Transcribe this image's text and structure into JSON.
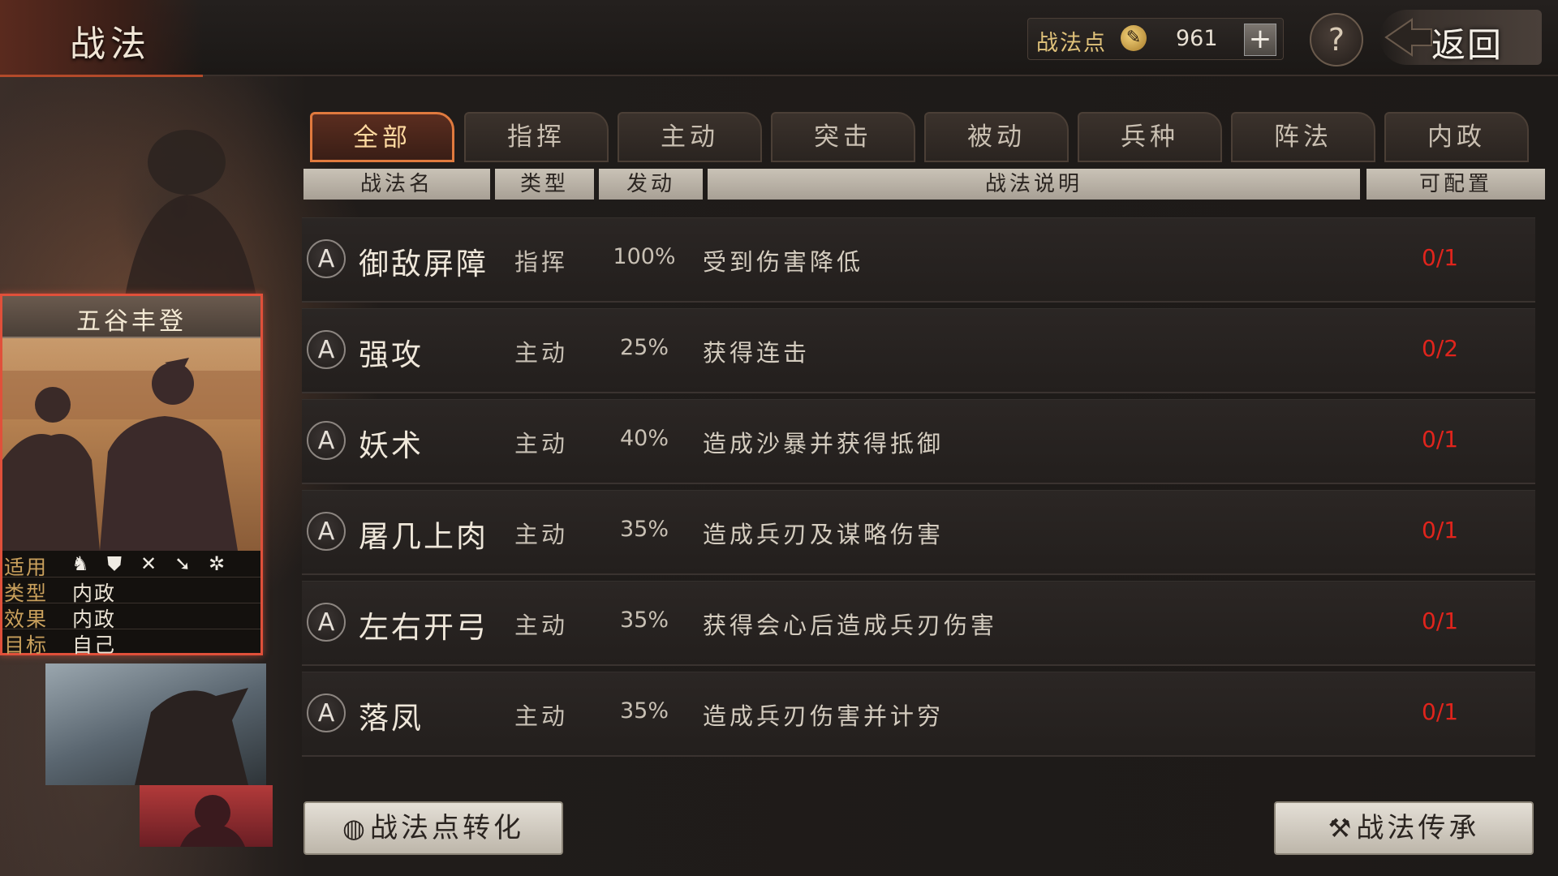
{
  "header": {
    "title": "战法",
    "points_label": "战法点",
    "points_icon": "feather-coin-icon",
    "points_value": "961",
    "plus_label": "+",
    "help_label": "?",
    "back_label": "返回"
  },
  "tabs": [
    {
      "label": "全部",
      "active": true
    },
    {
      "label": "指挥",
      "active": false
    },
    {
      "label": "主动",
      "active": false
    },
    {
      "label": "突击",
      "active": false
    },
    {
      "label": "被动",
      "active": false
    },
    {
      "label": "兵种",
      "active": false
    },
    {
      "label": "阵法",
      "active": false
    },
    {
      "label": "内政",
      "active": false
    }
  ],
  "columns": {
    "name": "战法名",
    "type": "类型",
    "trigger": "发动",
    "description": "战法说明",
    "configurable": "可配置"
  },
  "rows": [
    {
      "grade": "A",
      "name": "御敌屏障",
      "type": "指挥",
      "rate": "100%",
      "description": "受到伤害降低",
      "count": "0/1"
    },
    {
      "grade": "A",
      "name": "强攻",
      "type": "主动",
      "rate": "25%",
      "description": "获得连击",
      "count": "0/2"
    },
    {
      "grade": "A",
      "name": "妖术",
      "type": "主动",
      "rate": "40%",
      "description": "造成沙暴并获得抵御",
      "count": "0/1"
    },
    {
      "grade": "A",
      "name": "屠几上肉",
      "type": "主动",
      "rate": "35%",
      "description": "造成兵刃及谋略伤害",
      "count": "0/1"
    },
    {
      "grade": "A",
      "name": "左右开弓",
      "type": "主动",
      "rate": "35%",
      "description": "获得会心后造成兵刃伤害",
      "count": "0/1"
    },
    {
      "grade": "A",
      "name": "落凤",
      "type": "主动",
      "rate": "35%",
      "description": "造成兵刃伤害并计穷",
      "count": "0/1"
    }
  ],
  "card": {
    "title": "五谷丰登",
    "applicable_label": "适用",
    "unit_icons": [
      "cavalry-icon",
      "shield-icon",
      "archer-icon",
      "spear-icon",
      "siege-wheel-icon"
    ],
    "type_label": "类型",
    "type_value": "内政",
    "effect_label": "效果",
    "effect_value": "内政",
    "target_label": "目标",
    "target_value": "自己"
  },
  "buttons": {
    "convert_label": "战法点转化",
    "convert_icon": "coin-icon",
    "inherit_label": "战法传承",
    "inherit_icon": "hammer-icon"
  },
  "colors": {
    "active_tab_border": "#e07a3e",
    "count_color": "#e0241c",
    "card_border": "#e0503a",
    "gold_text": "#e0c27a"
  }
}
